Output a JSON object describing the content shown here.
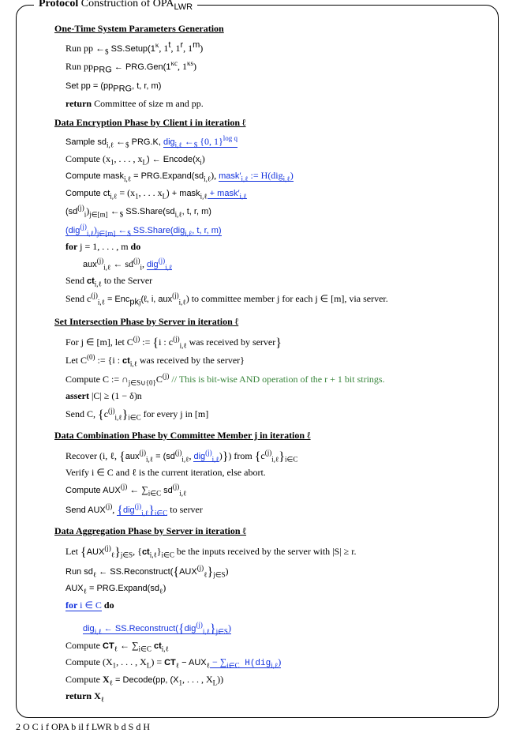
{
  "title": {
    "prefix": "Protocol",
    "rest": " Construction of OPA",
    "sub": "LWR"
  },
  "p1": {
    "header": "One-Time System Parameters Generation",
    "l1a": "Run pp ←",
    "l1b": " SS.Setup(1",
    "l1c": ", 1",
    "l1d": ", 1",
    "l1e": ", 1",
    "l1f": ")",
    "kappa": "κ",
    "t": "t",
    "r": "r",
    "m": "m",
    "l2a": "Run pp",
    "l2prg": "PRG",
    "l2b": " ← PRG.Gen(1",
    "l2c": ", 1",
    "l2d": ")",
    "kc": "κc",
    "ks": "κs",
    "l3a": "Set pp = (pp",
    "l3b": ", t, r, m)",
    "l4a": "return",
    "l4b": " Committee of size m and pp."
  },
  "p2": {
    "header": "Data Encryption Phase by Client i in iteration ℓ",
    "l1a": "Sample sd",
    "l1sub": "i,ℓ",
    "l1b": " ←",
    "l1c": " PRG.K, ",
    "l1d": "dig",
    "l1e": " ←",
    "l1f": " {0, 1}",
    "l1g": "log q",
    "l2a": "Compute (x",
    "l2b": ", . . . , x",
    "l2c": ") ← Encode(x",
    "l2d": ")",
    "one": "1",
    "L": "L",
    "i": "i",
    "l3a": "Compute mask",
    "l3b": " = PRG.Expand(sd",
    "l3c": "), ",
    "l3d": "mask′",
    "l3e": " := H(dig",
    "l3f": ")",
    "l4a": "Compute ct",
    "l4b": " = (x",
    "l4c": ", . . . x",
    "l4d": ") + mask",
    "l4e": " + mask′",
    "l5a": "(sd",
    "l5sup": "(j)",
    "l5sub": "i",
    "l5b": ")",
    "l5jm": "j∈[m]",
    "l5c": " ←",
    "l5d": " SS.Share(sd",
    "l5e": ", t, r, m)",
    "l6a": "(dig",
    "l6b": ")",
    "l6c": " ←",
    "l6d": " SS.Share(dig",
    "l6e": ", t, r, m)",
    "l7a": "for ",
    "l7b": "j = 1, . . . , m ",
    "l7c": "do",
    "l8a": "aux",
    "l8b": " ← sd",
    "l8c": ", ",
    "l8d": "dig",
    "l9a": "Send ",
    "l9b": "ct",
    "l9c": " to the Server",
    "l10a": "Send c",
    "l10b": " = Enc",
    "l10pk": "pk",
    "l10j": "j",
    "l10c": "(ℓ, i, aux",
    "l10d": ") to committee member j for each j ∈ [m], via server."
  },
  "p3": {
    "header": "Set Intersection Phase by Server in iteration ℓ",
    "l1a": "For j ∈ [m], let C",
    "l1b": " := ",
    "l1c": "i : c",
    "l1d": " was received by server",
    "l2a": "Let C",
    "l2sup0": "(0)",
    "l2b": " := {i : ",
    "l2ct": "ct",
    "l2c": " was received by the server}",
    "l3a": "Compute C := ∩",
    "l3sub": "j∈S∪{0}",
    "l3b": "C",
    "l3c": " ",
    "l3d": "// This is bit-wise AND operation of the r + 1 bit strings.",
    "l4a": "assert",
    "l4b": " |C| ≥ (1 − δ)n",
    "l5a": "Send C, ",
    "l5b": "c",
    "l5c": " for every j in [m]",
    "iC": "i∈C"
  },
  "p4": {
    "header": "Data Combination Phase by Committee Member j in iteration ℓ",
    "l1a": "Recover (i, ℓ, ",
    "l1b": "aux",
    "l1c": " = (sd",
    "l1d": ", ",
    "l1e": "dig",
    "l1f": ")",
    "l1g": ") from ",
    "l1h": "c",
    "l2a": "Verify i ∈ C and ℓ is the current iteration, else abort.",
    "l3a": "Compute AUX",
    "l3b": " ← ∑",
    "l3sub": "i∈C",
    "l3c": " sd",
    "l4a": "Send AUX",
    "l4b": ", ",
    "l4c": "dig",
    "l4d": " to server"
  },
  "p5": {
    "header": "Data Aggregation Phase by Server in iteration ℓ",
    "l1a": "Let ",
    "l1b": "AUX",
    "l1c": ", {",
    "l1ct": "ct",
    "l1d": "}",
    "l1iC": "i∈C",
    "l1e": " be the inputs received by the server with |S| ≥ r.",
    "jS": "j∈S",
    "l2a": "Run sd",
    "l2ell": "ℓ",
    "l2b": " ← SS.Reconstruct(",
    "l2c": "AUX",
    "l2d": ")",
    "l3a": "AUX",
    "l3b": " = PRG.Expand(sd",
    "l3c": ")",
    "l4a": "for ",
    "l4b": "i ∈ C",
    "l4c": " do",
    "l5a": "dig",
    "l5b": " ← SS.Reconstruct(",
    "l5c": "dig",
    "l5d": ")",
    "l6a": "Compute ",
    "l6b": "CT",
    "l6c": " ← ∑",
    "l6d": " ct",
    "l7a": "Compute (X",
    "l7b": ", . . . , X",
    "l7c": ") = ",
    "l7d": "CT",
    "l7e": " − AUX",
    "l7f": " − ∑",
    "l7g": " H(dig",
    "l7h": ")",
    "l8a": "Compute ",
    "l8b": "X",
    "l8c": " = Decode(pp, (X",
    "l8d": ", . . . , X",
    "l8e": "))",
    "l9a": "return X"
  },
  "caption": "2   O    C           i    f OPA b il  f        LWR b      d S    d H"
}
